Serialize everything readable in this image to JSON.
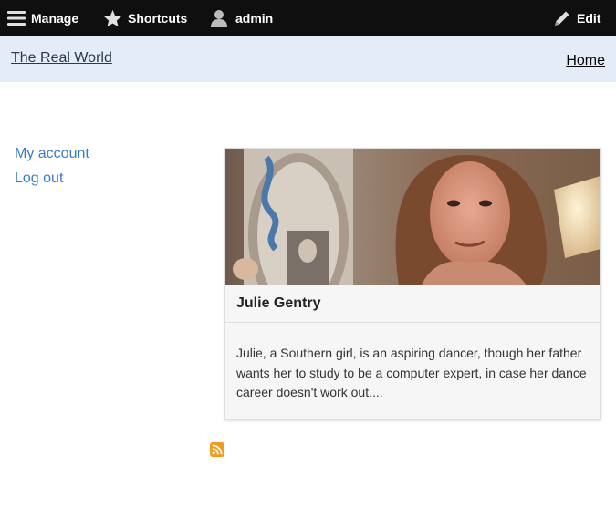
{
  "toolbar": {
    "manage_label": "Manage",
    "shortcuts_label": "Shortcuts",
    "user_label": "admin",
    "edit_label": "Edit",
    "icons": {
      "manage": "hamburger-menu-icon",
      "shortcuts": "star-icon",
      "user": "user-icon",
      "edit": "pencil-icon"
    },
    "colors": {
      "background": "#0f0f0f",
      "text": "#ffffff"
    }
  },
  "header": {
    "site_name": "The Real World",
    "home_label": "Home",
    "background": "#e4ecf8"
  },
  "sidebar": {
    "links": [
      {
        "label": "My account"
      },
      {
        "label": "Log out"
      }
    ],
    "link_color": "#3b7dc4"
  },
  "card": {
    "title": "Julie Gentry",
    "body": "Julie, a Southern girl, is an aspiring dancer, though her father wants her to study to be a computer expert, in case her dance career doesn't work out...."
  },
  "feed": {
    "icon": "rss-feed-icon",
    "color": "#f29a1f"
  }
}
